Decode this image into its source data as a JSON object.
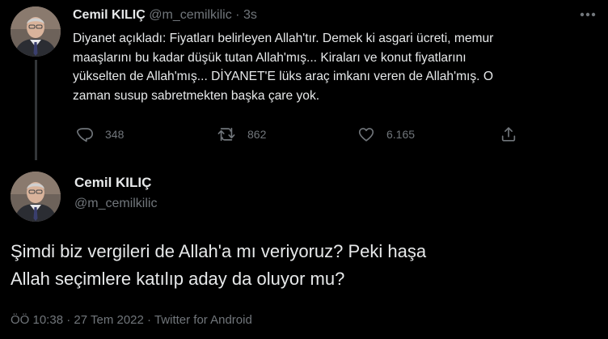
{
  "colors": {
    "background": "#000000",
    "text_primary": "#e7e9ea",
    "text_secondary": "#71767b",
    "thread_line": "#333639"
  },
  "tweet_reply_parent": {
    "author_name": "Cemil KILIÇ",
    "author_handle": "@m_cemilkilic",
    "separator": "·",
    "time_ago": "3s",
    "text": "Diyanet açıkladı: Fiyatları belirleyen Allah'tır. Demek ki asgari ücreti, memur\nmaaşlarını bu kadar düşük tutan Allah'mış... Kiraları ve konut fiyatlarını\nyükselten de Allah'mış... DİYANET'E lüks araç imkanı veren de Allah'mış. O\nzaman susup sabretmekten başka çare yok.",
    "stats": {
      "replies": "348",
      "retweets": "862",
      "likes": "6.165"
    },
    "icons": [
      "more-icon",
      "reply-icon",
      "retweet-icon",
      "like-icon",
      "share-icon"
    ]
  },
  "tweet_focused": {
    "author_name": "Cemil KILIÇ",
    "author_handle": "@m_cemilkilic",
    "text": "Şimdi biz vergileri de Allah'a mı veriyoruz? Peki haşa\nAllah seçimlere katılıp aday da oluyor mu?",
    "time": "ÖÖ 10:38",
    "separator": "·",
    "date": "27 Tem 2022",
    "separator2": "·",
    "source": "Twitter for Android"
  }
}
